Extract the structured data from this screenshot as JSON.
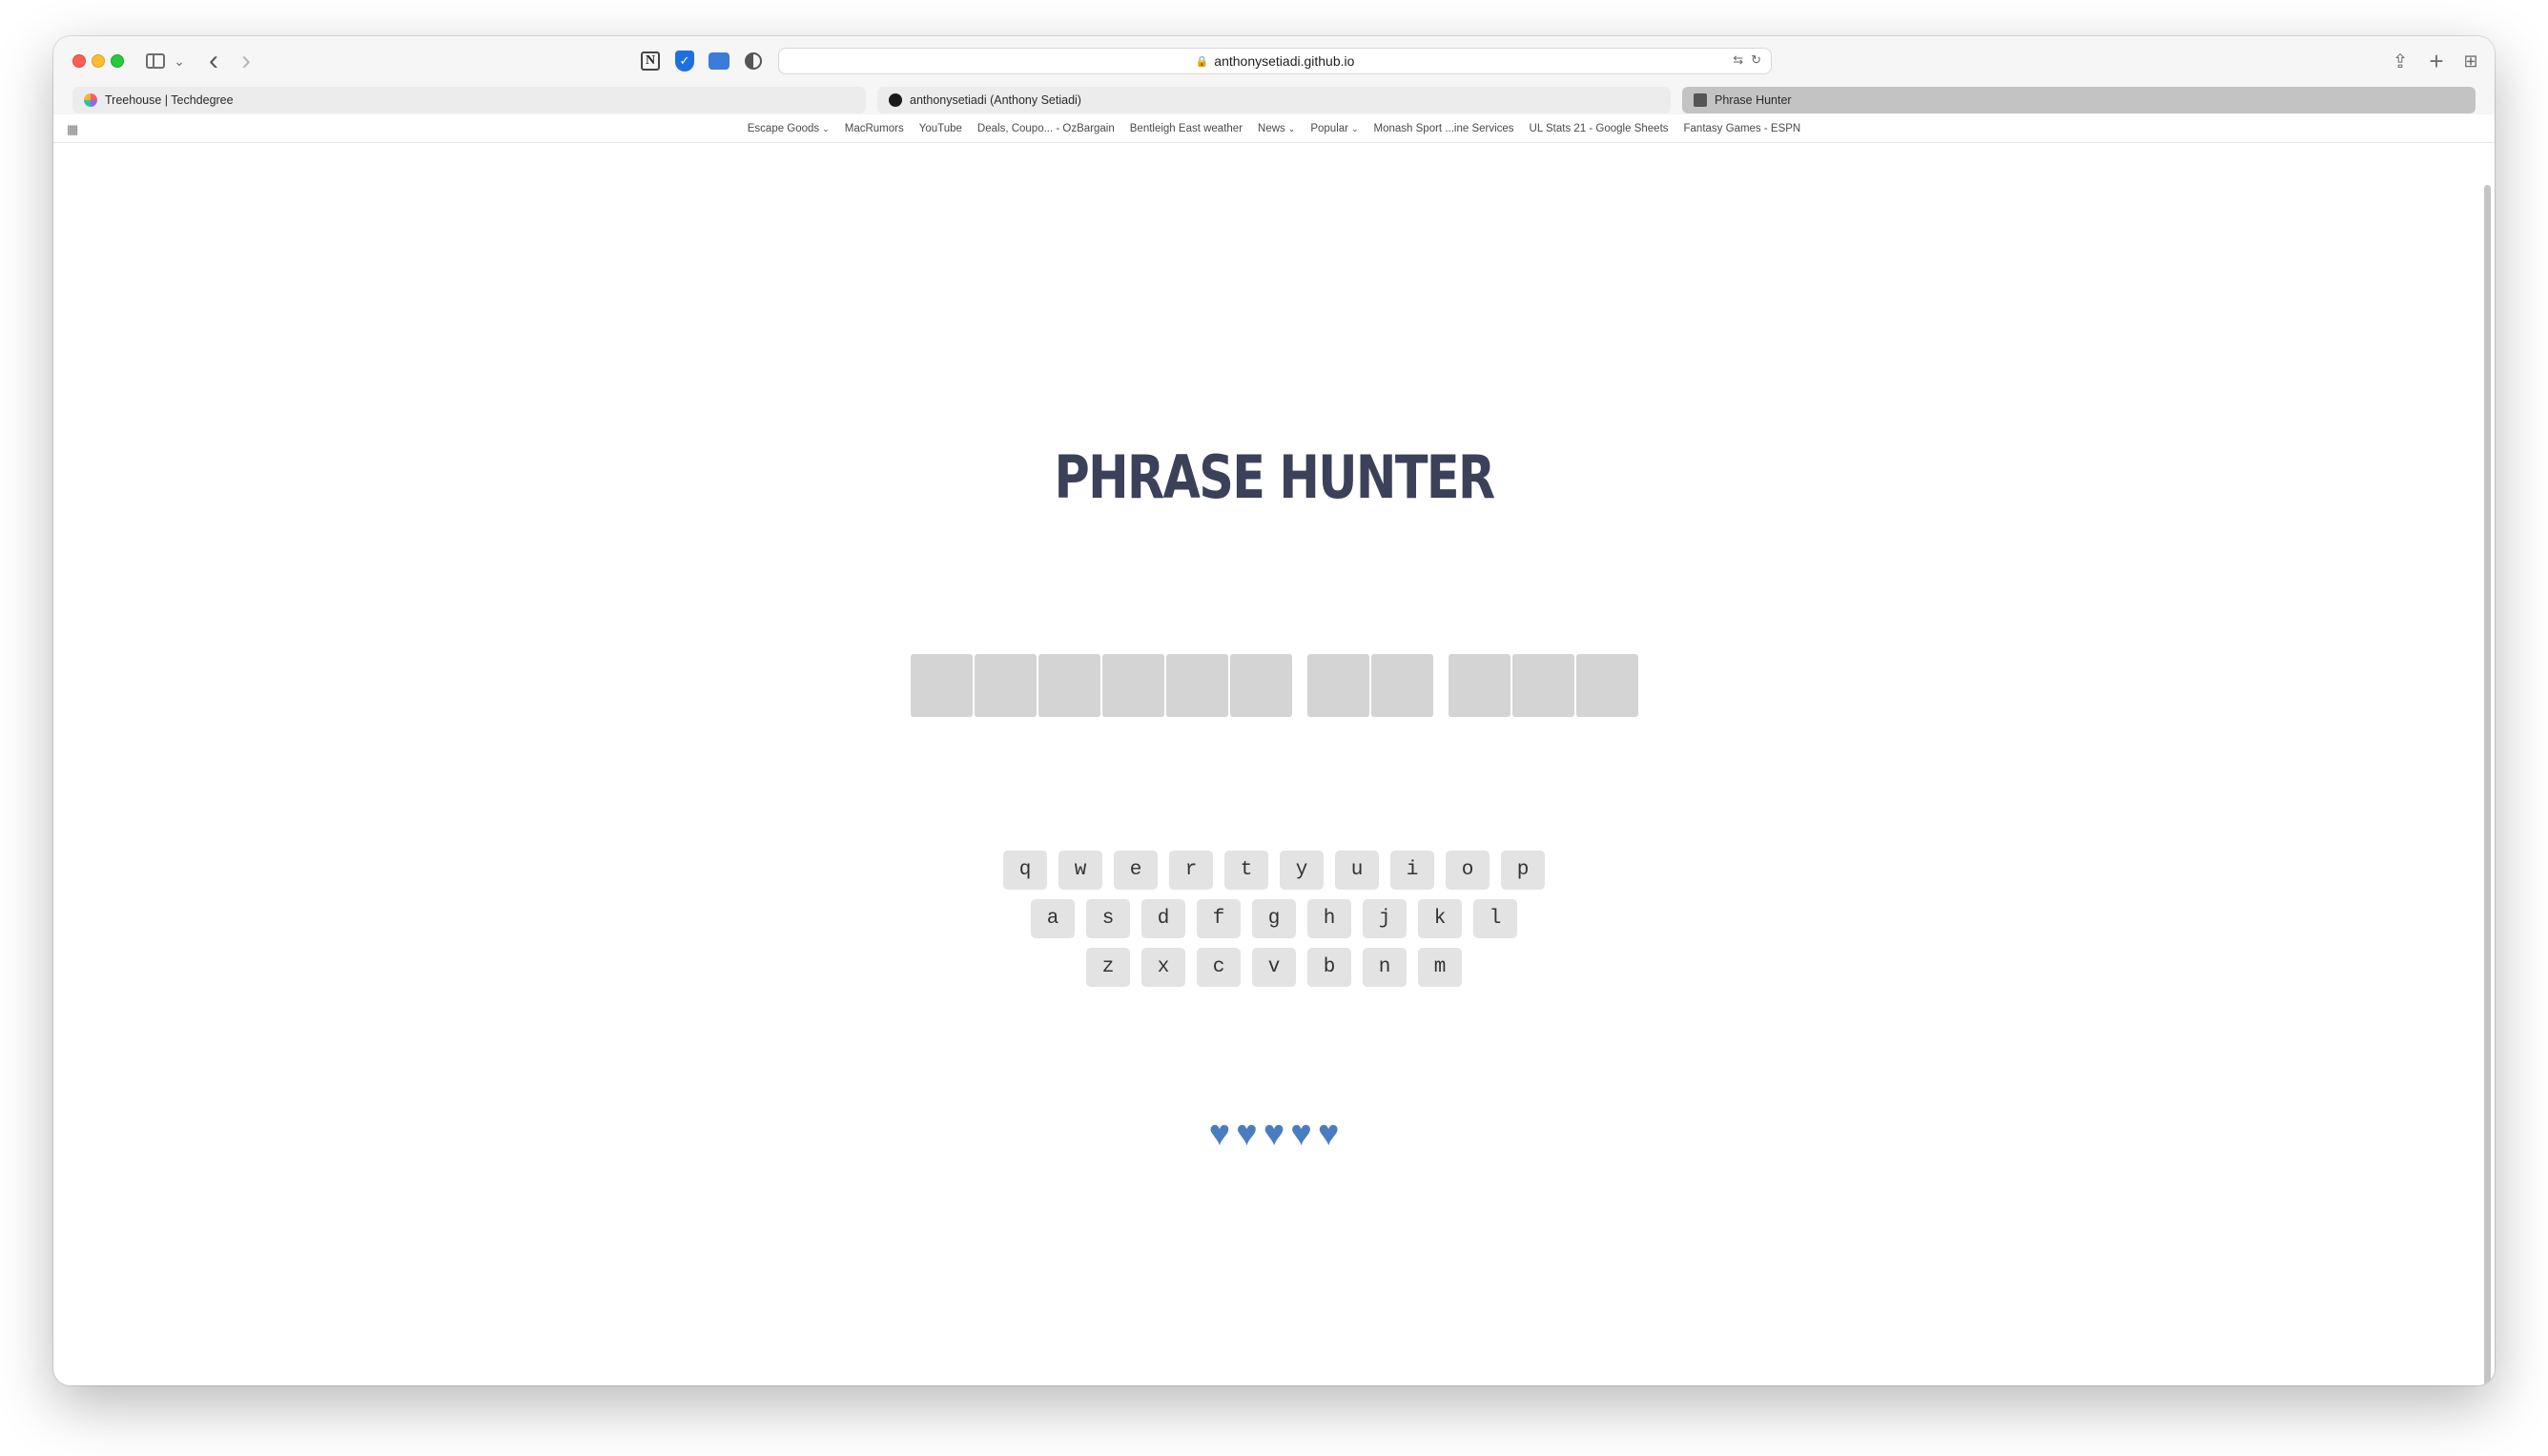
{
  "browser": {
    "url": "anthonysetiadi.github.io",
    "tabs": [
      {
        "title": "Treehouse | Techdegree",
        "favicon": "treehouse-icon",
        "active": false
      },
      {
        "title": "anthonysetiadi (Anthony Setiadi)",
        "favicon": "github-icon",
        "active": false
      },
      {
        "title": "Phrase Hunter",
        "favicon": "page-icon",
        "active": true
      }
    ],
    "bookmarks": [
      {
        "label": "Escape Goods",
        "has_menu": true
      },
      {
        "label": "MacRumors",
        "has_menu": false
      },
      {
        "label": "YouTube",
        "has_menu": false
      },
      {
        "label": "Deals, Coupo... - OzBargain",
        "has_menu": false
      },
      {
        "label": "Bentleigh East weather",
        "has_menu": false
      },
      {
        "label": "News",
        "has_menu": true
      },
      {
        "label": "Popular",
        "has_menu": true
      },
      {
        "label": "Monash Sport ...ine Services",
        "has_menu": false
      },
      {
        "label": "UL Stats 21 - Google Sheets",
        "has_menu": false
      },
      {
        "label": "Fantasy Games - ESPN",
        "has_menu": false
      }
    ]
  },
  "game": {
    "title": "PHRASE HUNTER",
    "phrase_words": [
      6,
      2,
      3
    ],
    "keyboard": [
      [
        "q",
        "w",
        "e",
        "r",
        "t",
        "y",
        "u",
        "i",
        "o",
        "p"
      ],
      [
        "a",
        "s",
        "d",
        "f",
        "g",
        "h",
        "j",
        "k",
        "l"
      ],
      [
        "z",
        "x",
        "c",
        "v",
        "b",
        "n",
        "m"
      ]
    ],
    "lives": 5,
    "heart_color": "#4a7dbf"
  }
}
